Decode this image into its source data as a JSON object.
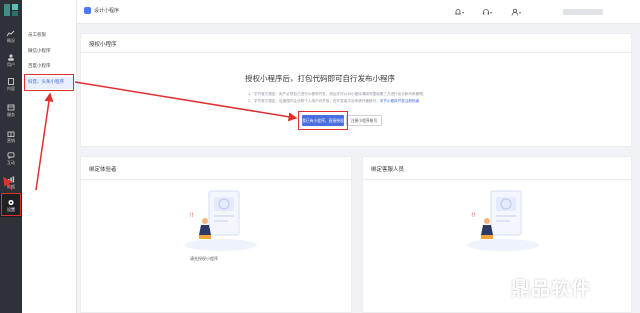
{
  "rail": {
    "items": [
      {
        "label": "概况",
        "icon": "chart-icon"
      },
      {
        "label": "用户",
        "icon": "users-icon"
      },
      {
        "label": "内容",
        "icon": "document-icon"
      },
      {
        "label": "服务",
        "icon": "service-icon"
      },
      {
        "label": "营销",
        "icon": "gift-icon"
      },
      {
        "label": "互动",
        "icon": "chat-icon"
      },
      {
        "label": "数据",
        "icon": "data-icon"
      },
      {
        "label": "设置",
        "icon": "gear-icon"
      }
    ]
  },
  "submenu": {
    "items": [
      {
        "label": "员工权限"
      },
      {
        "label": "微信小程序"
      },
      {
        "label": "百度小程序"
      },
      {
        "label": "抖音、头条小程序"
      }
    ]
  },
  "topbar": {
    "app_name": "设计小程序",
    "icons": [
      "bell-icon",
      "headset-icon",
      "user-icon"
    ]
  },
  "authorize_panel": {
    "title": "授权小程序",
    "main_title": "授权小程序后，打包代码即可自行发布小程序",
    "notes": [
      "1、字节官方规定：用户必须自己进行小程序开发，然后才可以对小程序调用完整版第三方进行设计和代码管理。",
      "2、字节官方规定：百度国内企业和个人用户均开放，在开发者平台申请开通即可。"
    ],
    "notes_link": "字节小程序开发注册指南",
    "primary_button": "我已有小程序，直接授权",
    "secondary_button": "注册小程序账号"
  },
  "tester_panel": {
    "title": "绑定体验者",
    "caption": "请先授权小程序"
  },
  "support_panel": {
    "title": "绑定客服人员"
  },
  "watermark": {
    "text": "鼎品软件"
  },
  "colors": {
    "accent": "#4a6fe0",
    "highlight": "#e03030",
    "rail": "#2e3238"
  }
}
